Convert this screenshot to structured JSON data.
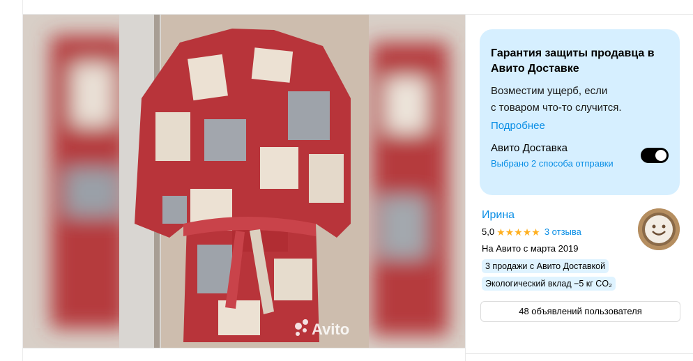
{
  "gallery": {
    "watermark": "Avito",
    "image_alt": "bathrobe-photo"
  },
  "guarantee": {
    "title": "Гарантия защиты продавца в Авито Доставке",
    "text_line1": "Возместим ущерб, если",
    "text_line2": "с товаром что-то случится.",
    "more_link": "Подробнее",
    "delivery_title": "Авито Доставка",
    "delivery_subtitle": "Выбрано 2 способа отправки",
    "toggle_on": true
  },
  "seller": {
    "name": "Ирина",
    "rating": "5,0",
    "stars": "★★★★★",
    "reviews": "3 отзыва",
    "since": "На Авито с марта 2019",
    "badge_sales": "3 продажи с Авито Доставкой",
    "badge_eco": "Экологический вклад −5 кг CO₂",
    "ads_button": "48 объявлений пользователя"
  },
  "colors": {
    "accent": "#0a8ee5",
    "panel": "#d6efff",
    "star": "#ffb021"
  }
}
